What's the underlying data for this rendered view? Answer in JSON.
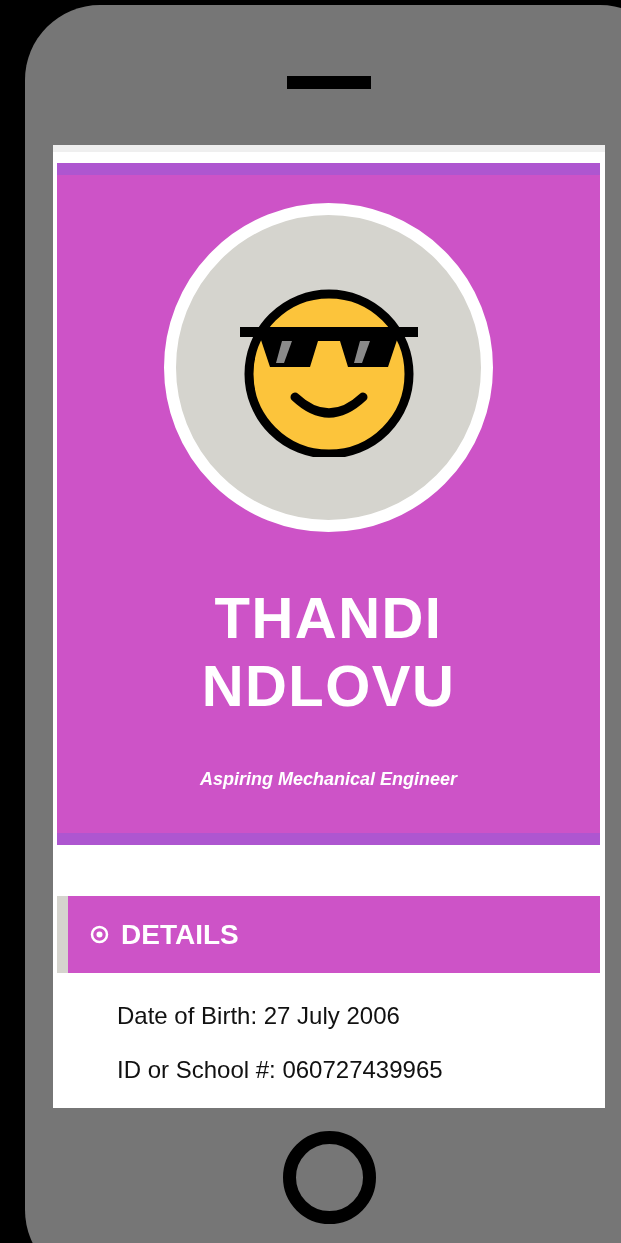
{
  "profile": {
    "name_lines": [
      "THANDI",
      "NDLOVU"
    ],
    "tagline": "Aspiring Mechanical Engineer"
  },
  "details": {
    "heading": "DETAILS",
    "items": [
      "Date of Birth: 27 July 2006",
      "ID or School #: 060727439965"
    ]
  }
}
